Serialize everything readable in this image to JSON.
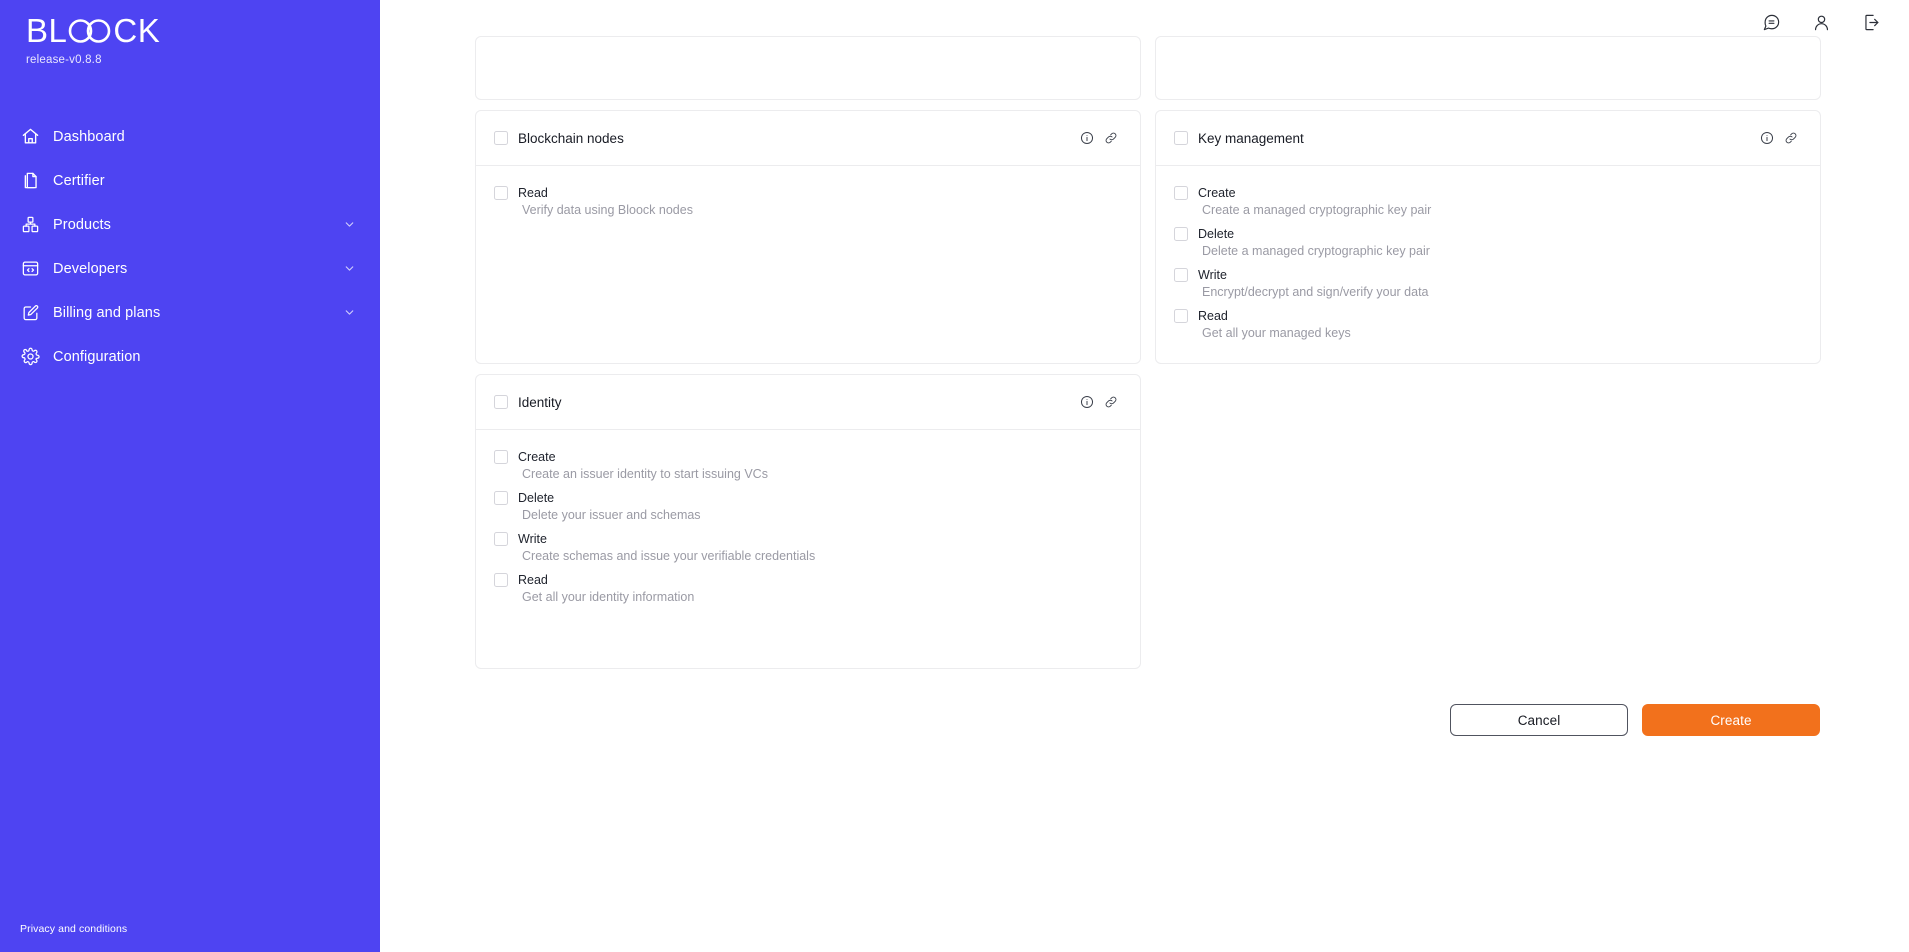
{
  "brand": {
    "logo_part1": "BL",
    "logo_part2": "CK",
    "logo_icon": "infinity-mark",
    "release": "release-v0.8.8"
  },
  "colors": {
    "sidebar_bg": "#4E44F2",
    "primary_action": "#F2711C",
    "card_border": "#ececee",
    "muted_text": "#9a9aa4"
  },
  "sidebar": {
    "items": [
      {
        "label": "Dashboard",
        "icon": "home-icon",
        "expandable": false
      },
      {
        "label": "Certifier",
        "icon": "document-icon",
        "expandable": false
      },
      {
        "label": "Products",
        "icon": "cubes-icon",
        "expandable": true
      },
      {
        "label": "Developers",
        "icon": "code-window-icon",
        "expandable": true
      },
      {
        "label": "Billing and plans",
        "icon": "edit-square-icon",
        "expandable": true
      },
      {
        "label": "Configuration",
        "icon": "gear-icon",
        "expandable": false
      }
    ],
    "footer_link": "Privacy and conditions"
  },
  "topbar": {
    "icons": [
      {
        "name": "chat-icon"
      },
      {
        "name": "user-icon"
      },
      {
        "name": "logout-icon"
      }
    ]
  },
  "cards": [
    {
      "id": "blockchain-nodes",
      "title": "Blockchain nodes",
      "checked": false,
      "info_icon": "info-icon",
      "link_icon": "link-icon",
      "permissions": [
        {
          "name": "Read",
          "desc": "Verify data using Bloock nodes",
          "checked": false
        }
      ]
    },
    {
      "id": "key-management",
      "title": "Key management",
      "checked": false,
      "info_icon": "info-icon",
      "link_icon": "link-icon",
      "permissions": [
        {
          "name": "Create",
          "desc": "Create a managed cryptographic key pair",
          "checked": false
        },
        {
          "name": "Delete",
          "desc": "Delete a managed cryptographic key pair",
          "checked": false
        },
        {
          "name": "Write",
          "desc": "Encrypt/decrypt and sign/verify your data",
          "checked": false
        },
        {
          "name": "Read",
          "desc": "Get all your managed keys",
          "checked": false
        }
      ]
    },
    {
      "id": "identity",
      "title": "Identity",
      "checked": false,
      "info_icon": "info-icon",
      "link_icon": "link-icon",
      "permissions": [
        {
          "name": "Create",
          "desc": "Create an issuer identity to start issuing VCs",
          "checked": false
        },
        {
          "name": "Delete",
          "desc": "Delete your issuer and schemas",
          "checked": false
        },
        {
          "name": "Write",
          "desc": "Create schemas and issue your verifiable credentials",
          "checked": false
        },
        {
          "name": "Read",
          "desc": "Get all your identity information",
          "checked": false
        }
      ]
    }
  ],
  "actions": {
    "cancel_label": "Cancel",
    "create_label": "Create"
  }
}
